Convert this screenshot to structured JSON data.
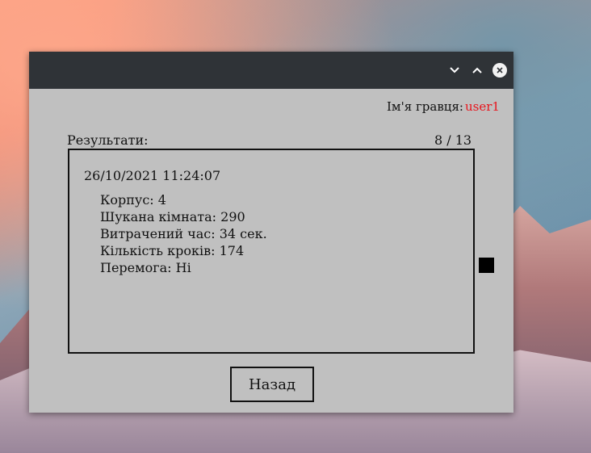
{
  "window": {
    "controls": {
      "minimize_icon": "chevron-down-icon",
      "maximize_icon": "chevron-up-icon",
      "close_icon": "close-icon"
    }
  },
  "player": {
    "label": "Ім'я гравця:",
    "name": "user1",
    "name_color": "#e8141c"
  },
  "results": {
    "label": "Результати:",
    "page_counter": "8 / 13",
    "entry": {
      "datetime": "26/10/2021 11:24:07",
      "details": [
        "Корпус: 4",
        "Шукана кімната: 290",
        "Витрачений час: 34 сек.",
        "Кількість кроків: 174",
        "Перемога: Ні"
      ]
    }
  },
  "buttons": {
    "back": "Назад"
  }
}
